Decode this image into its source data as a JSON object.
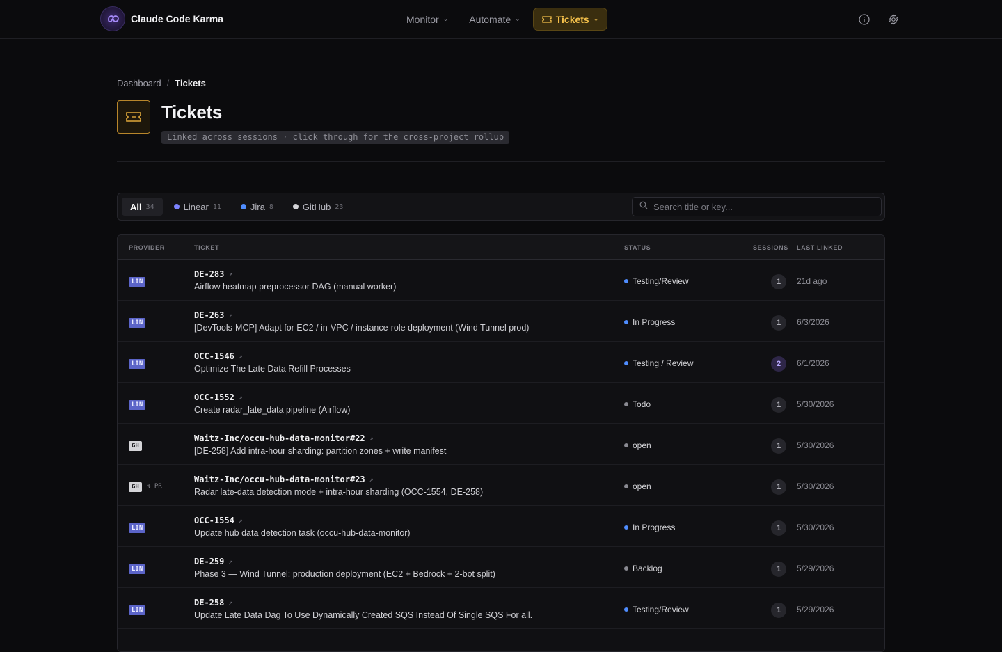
{
  "app": {
    "name": "Claude Code Karma"
  },
  "nav": {
    "items": [
      {
        "label": "Monitor"
      },
      {
        "label": "Automate"
      },
      {
        "label": "Tickets"
      }
    ]
  },
  "breadcrumb": {
    "root": "Dashboard",
    "current": "Tickets"
  },
  "header": {
    "title": "Tickets",
    "subtitle": "Linked across sessions · click through for the cross-project rollup"
  },
  "filters": {
    "tabs": [
      {
        "label": "All",
        "count": "34"
      },
      {
        "label": "Linear",
        "count": "11",
        "color": "#7c83ff"
      },
      {
        "label": "Jira",
        "count": "8",
        "color": "#4f8dff"
      },
      {
        "label": "GitHub",
        "count": "23",
        "color": "#d4d4d8"
      }
    ],
    "search_placeholder": "Search title or key..."
  },
  "table": {
    "headers": {
      "provider": "PROVIDER",
      "ticket": "TICKET",
      "status": "STATUS",
      "sessions": "SESSIONS",
      "last_linked": "LAST LINKED"
    },
    "rows": [
      {
        "provider": "LIN",
        "pr": "",
        "key": "DE-283",
        "title": "Airflow heatmap preprocessor DAG (manual worker)",
        "status": "Testing/Review",
        "status_color": "#4f8dff",
        "sessions": "1",
        "last_linked": "21d ago"
      },
      {
        "provider": "LIN",
        "pr": "",
        "key": "DE-263",
        "title": "[DevTools-MCP] Adapt for EC2 / in-VPC / instance-role deployment (Wind Tunnel prod)",
        "status": "In Progress",
        "status_color": "#4f8dff",
        "sessions": "1",
        "last_linked": "6/3/2026"
      },
      {
        "provider": "LIN",
        "pr": "",
        "key": "OCC-1546",
        "title": "Optimize The Late Data Refill Processes",
        "status": "Testing / Review",
        "status_color": "#4f8dff",
        "sessions": "2",
        "last_linked": "6/1/2026"
      },
      {
        "provider": "LIN",
        "pr": "",
        "key": "OCC-1552",
        "title": "Create radar_late_data pipeline (Airflow)",
        "status": "Todo",
        "status_color": "#8a8a92",
        "sessions": "1",
        "last_linked": "5/30/2026"
      },
      {
        "provider": "GH",
        "pr": "",
        "key": "Waitz-Inc/occu-hub-data-monitor#22",
        "title": "[DE-258] Add intra-hour sharding: partition zones + write manifest",
        "status": "open",
        "status_color": "#8a8a92",
        "sessions": "1",
        "last_linked": "5/30/2026"
      },
      {
        "provider": "GH",
        "pr": "PR",
        "key": "Waitz-Inc/occu-hub-data-monitor#23",
        "title": "Radar late-data detection mode + intra-hour sharding (OCC-1554, DE-258)",
        "status": "open",
        "status_color": "#8a8a92",
        "sessions": "1",
        "last_linked": "5/30/2026"
      },
      {
        "provider": "LIN",
        "pr": "",
        "key": "OCC-1554",
        "title": "Update hub data detection task (occu-hub-data-monitor)",
        "status": "In Progress",
        "status_color": "#4f8dff",
        "sessions": "1",
        "last_linked": "5/30/2026"
      },
      {
        "provider": "LIN",
        "pr": "",
        "key": "DE-259",
        "title": "Phase 3 — Wind Tunnel: production deployment (EC2 + Bedrock + 2-bot split)",
        "status": "Backlog",
        "status_color": "#8a8a92",
        "sessions": "1",
        "last_linked": "5/29/2026"
      },
      {
        "provider": "LIN",
        "pr": "",
        "key": "DE-258",
        "title": "Update Late Data Dag To Use Dynamically Created SQS Instead Of Single SQS For all.",
        "status": "Testing/Review",
        "status_color": "#4f8dff",
        "sessions": "1",
        "last_linked": "5/29/2026"
      }
    ]
  }
}
